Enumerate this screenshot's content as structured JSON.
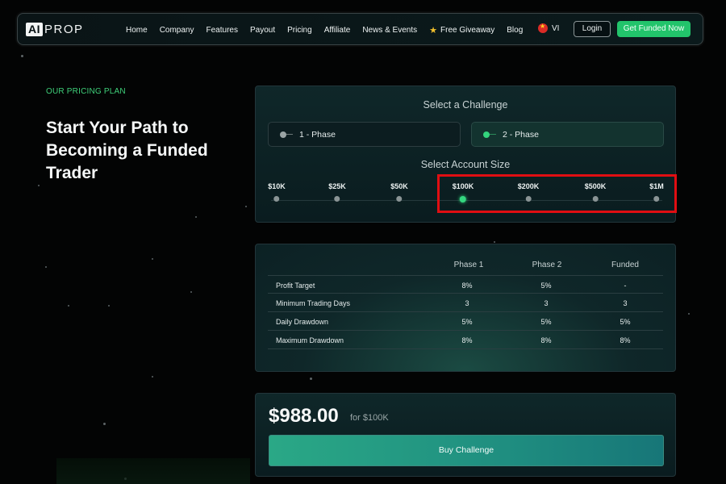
{
  "nav": {
    "logo_box": "AI",
    "logo_text": "PROP",
    "links": [
      "Home",
      "Company",
      "Features",
      "Payout",
      "Pricing",
      "Affiliate",
      "News & Events",
      "Free Giveaway",
      "Blog"
    ],
    "lang": "VI",
    "login": "Login",
    "get_funded": "Get Funded Now"
  },
  "hero": {
    "eyebrow": "OUR PRICING PLAN",
    "title": "Start Your Path to Becoming a Funded Trader"
  },
  "challenge": {
    "title": "Select a Challenge",
    "phases": [
      "1 - Phase",
      "2 - Phase"
    ],
    "selected_phase": "2 - Phase",
    "size_title": "Select Account Size",
    "sizes": [
      "$10K",
      "$25K",
      "$50K",
      "$100K",
      "$200K",
      "$500K",
      "$1M"
    ],
    "selected_size": "$100K"
  },
  "table": {
    "headers": [
      "Phase 1",
      "Phase 2",
      "Funded"
    ],
    "rows": [
      {
        "label": "Profit Target",
        "values": [
          "8%",
          "5%",
          "-"
        ]
      },
      {
        "label": "Minimum Trading Days",
        "values": [
          "3",
          "3",
          "3"
        ]
      },
      {
        "label": "Daily Drawdown",
        "values": [
          "5%",
          "5%",
          "5%"
        ]
      },
      {
        "label": "Maximum Drawdown",
        "values": [
          "8%",
          "8%",
          "8%"
        ]
      }
    ]
  },
  "price": {
    "value": "$988.00",
    "for": "for $100K",
    "buy": "Buy Challenge"
  },
  "colors": {
    "accent_green": "#22c46b",
    "highlight_red": "#e00e12",
    "eyebrow_green": "#3fd07a"
  }
}
